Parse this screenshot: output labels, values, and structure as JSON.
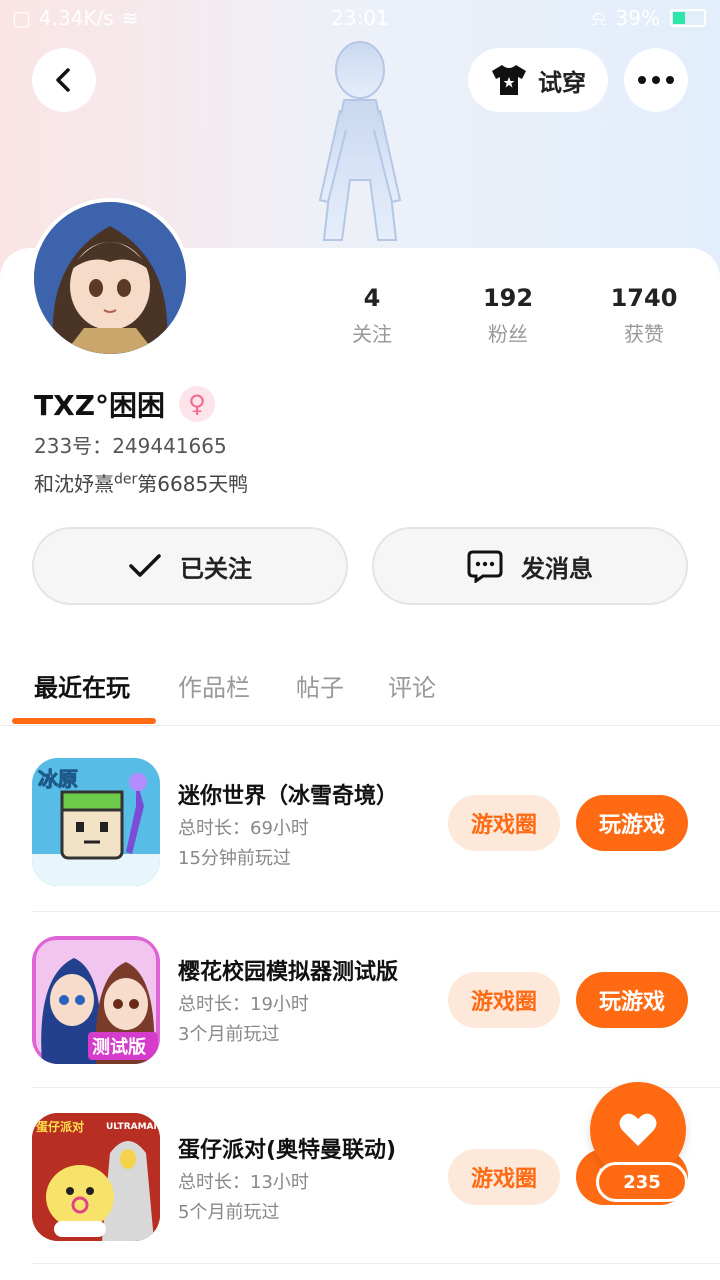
{
  "status_bar": {
    "speed": "4.34K/s",
    "time": "23:01",
    "battery": "39%",
    "battery_level": 0.39
  },
  "header": {
    "back_icon": "chevron-left-icon",
    "tryon_label": "试穿",
    "tryon_icon": "tshirt-icon",
    "more_icon": "more-dots-icon"
  },
  "profile": {
    "username": "TXZ°困困",
    "gender_symbol": "♀",
    "uid_label": "233号：",
    "uid": "249441665",
    "bio_prefix": "和沈妤熹",
    "bio_sup": "der",
    "bio_suffix": "第6685天鸭"
  },
  "stats": [
    {
      "value": "4",
      "label": "关注"
    },
    {
      "value": "192",
      "label": "粉丝"
    },
    {
      "value": "1740",
      "label": "获赞"
    }
  ],
  "actions": {
    "follow_label": "已关注",
    "message_label": "发消息"
  },
  "tabs": [
    {
      "label": "最近在玩"
    },
    {
      "label": "作品栏"
    },
    {
      "label": "帖子"
    },
    {
      "label": "评论"
    }
  ],
  "games": [
    {
      "title": "迷你世界（冰雪奇境）",
      "duration": "总时长：69小时",
      "last_played": "15分钟前玩过",
      "circle_label": "游戏圈",
      "play_label": "玩游戏",
      "icon_text": "冰原"
    },
    {
      "title": "樱花校园模拟器测试版",
      "duration": "总时长：19小时",
      "last_played": "3个月前玩过",
      "circle_label": "游戏圈",
      "play_label": "玩游戏",
      "icon_text": "测试版"
    },
    {
      "title": "蛋仔派对(奥特曼联动)",
      "duration": "总时长：13小时",
      "last_played": "5个月前玩过",
      "circle_label": "游戏圈",
      "play_label": "玩游戏",
      "icon_text": "蛋仔派对",
      "icon_badge": "ULTRAMAN 奥特曼"
    }
  ],
  "like": {
    "count": "235",
    "icon": "heart-icon"
  },
  "colors": {
    "accent": "#ff6a13",
    "accent_light": "#fde8d9"
  }
}
